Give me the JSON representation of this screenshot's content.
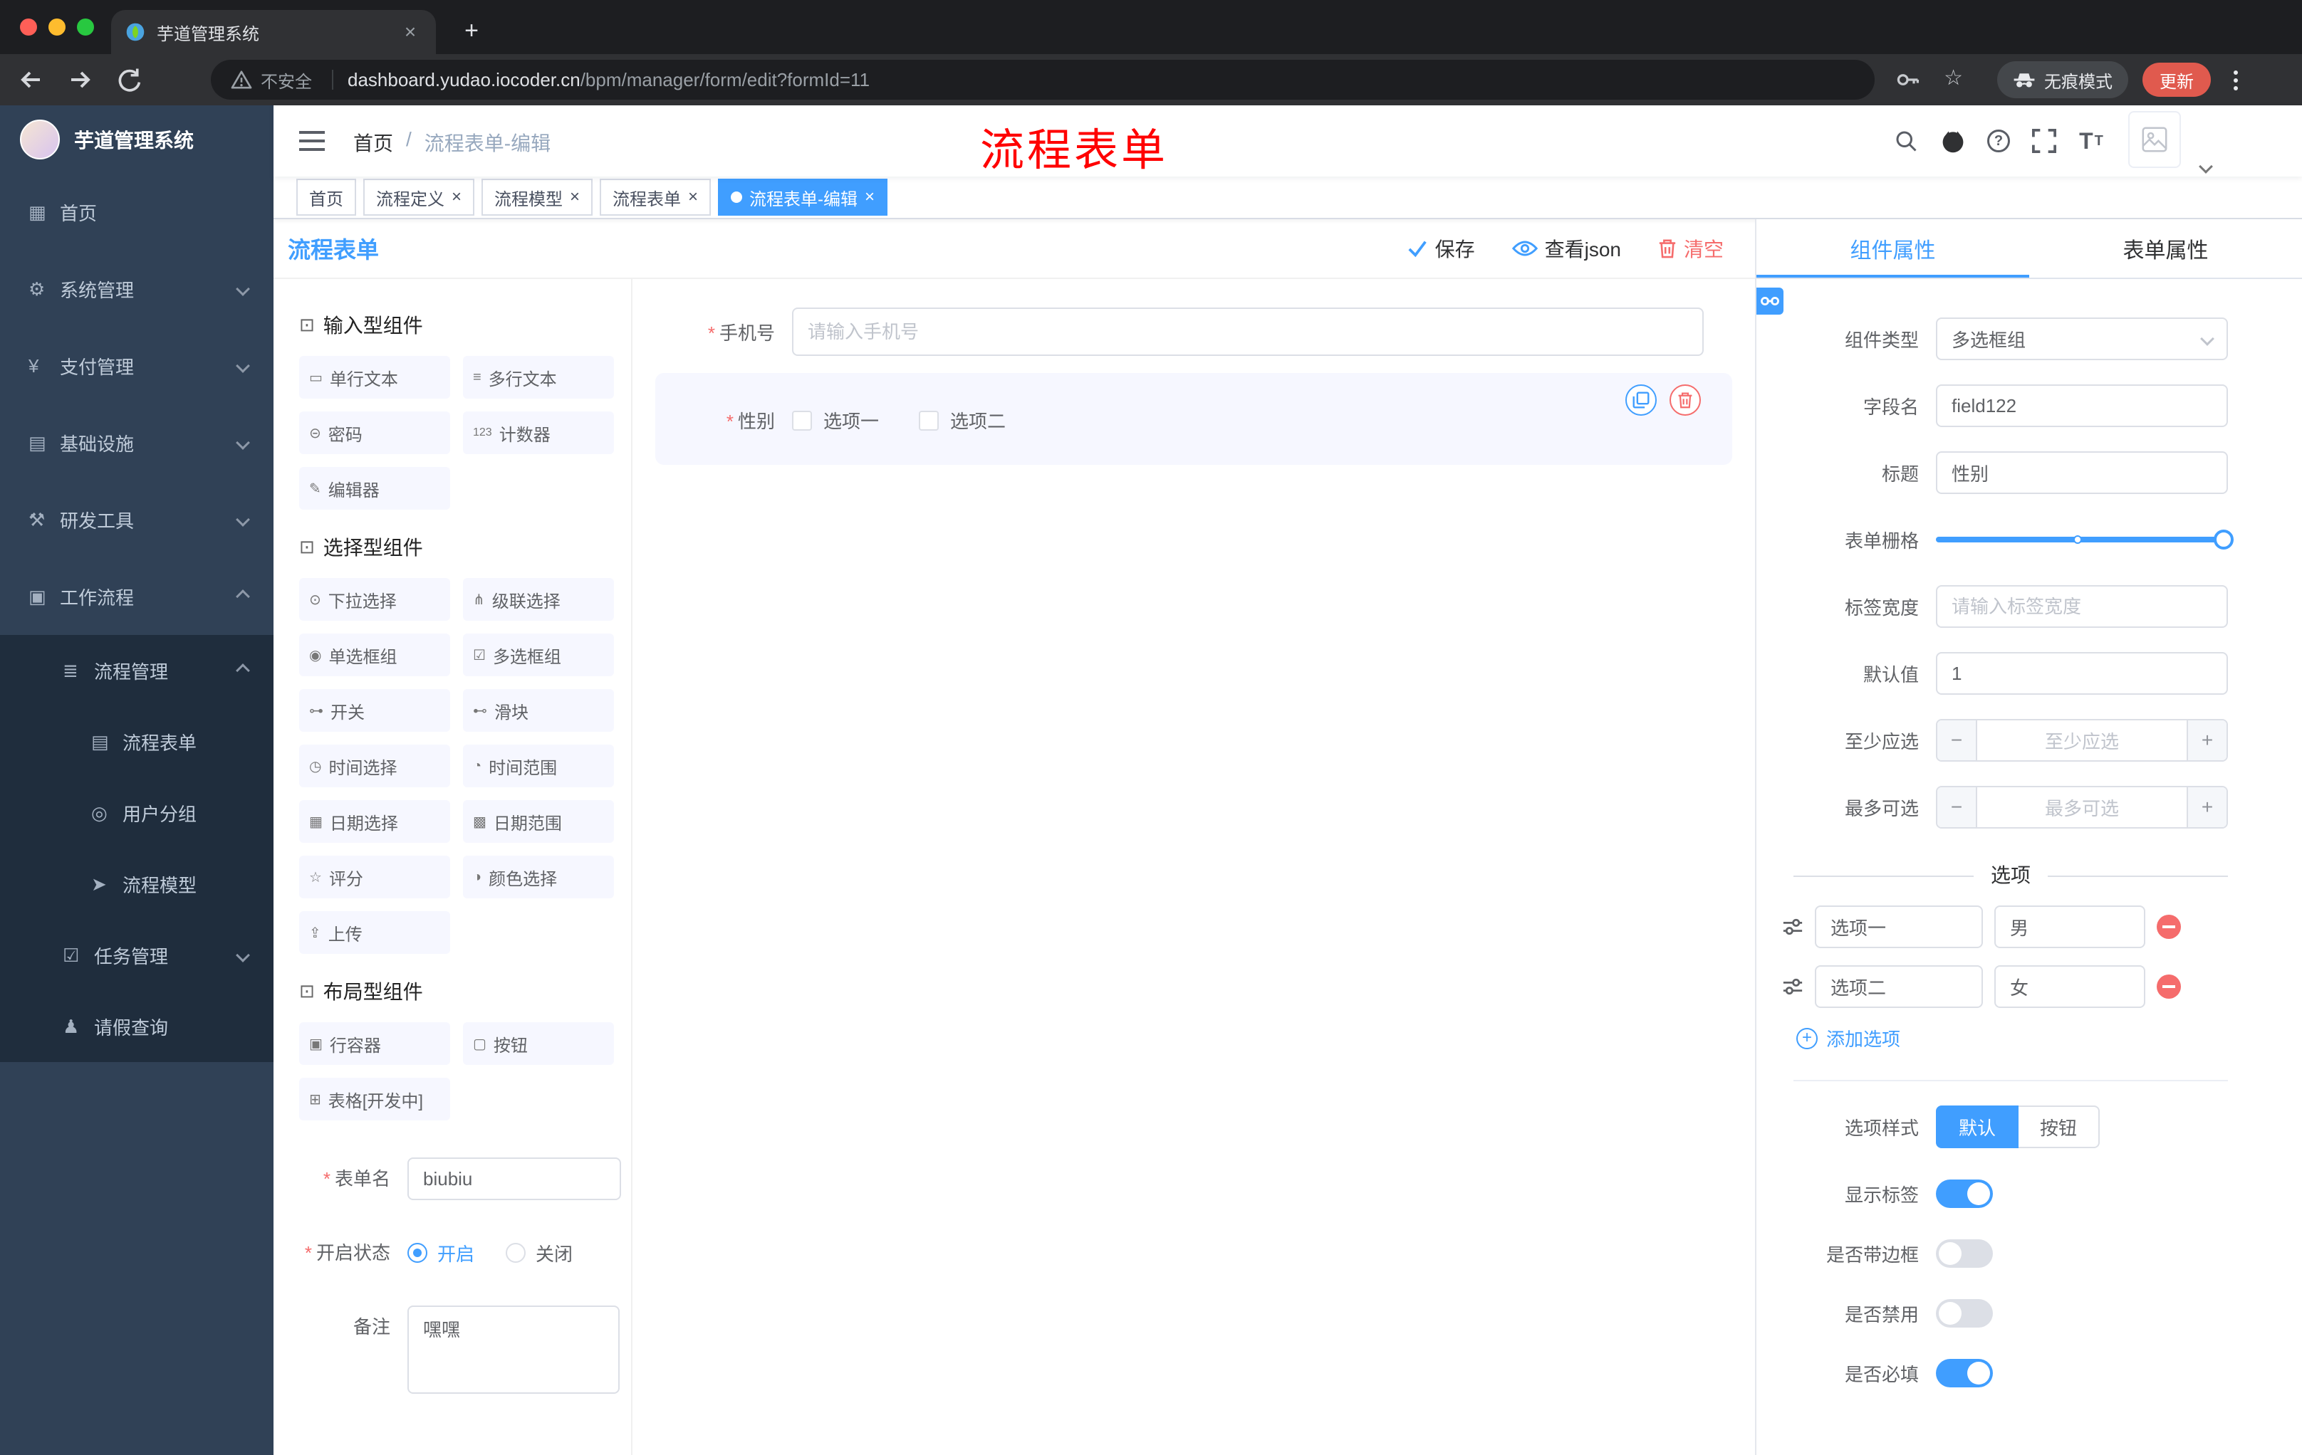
{
  "browser": {
    "tab": {
      "title": "芋道管理系统"
    },
    "address": {
      "security": "不安全",
      "url_host": "dashboard.yudao.iocoder.cn",
      "url_path": "/bpm/manager/form/edit?formId=11",
      "incognito": "无痕模式",
      "update": "更新"
    }
  },
  "sidebar": {
    "logo_title": "芋道管理系统",
    "items": [
      {
        "label": "首页",
        "glyph": "▦"
      },
      {
        "label": "系统管理",
        "glyph": "⚙"
      },
      {
        "label": "支付管理",
        "glyph": "¥"
      },
      {
        "label": "基础设施",
        "glyph": "▤"
      },
      {
        "label": "研发工具",
        "glyph": "⚒"
      },
      {
        "label": "工作流程",
        "glyph": "▣"
      },
      {
        "label": "流程管理",
        "glyph": "≣"
      },
      {
        "label": "流程表单",
        "glyph": "▤"
      },
      {
        "label": "用户分组",
        "glyph": "◎"
      },
      {
        "label": "流程模型",
        "glyph": "➤"
      },
      {
        "label": "任务管理",
        "glyph": "☑"
      },
      {
        "label": "请假查询",
        "glyph": "♟"
      }
    ]
  },
  "navbar": {
    "breadcrumb": {
      "home": "首页",
      "separator": "/",
      "current": "流程表单-编辑"
    },
    "annotation": "流程表单"
  },
  "tags": [
    {
      "label": "首页"
    },
    {
      "label": "流程定义"
    },
    {
      "label": "流程模型"
    },
    {
      "label": "流程表单"
    },
    {
      "label": "流程表单-编辑"
    }
  ],
  "designer": {
    "title": "流程表单",
    "actions": {
      "save": "保存",
      "view_json": "查看json",
      "clear": "清空"
    }
  },
  "palette": {
    "groups": [
      {
        "title": "输入型组件",
        "glyph": "⊡",
        "items": [
          {
            "label": "单行文本",
            "glyph": "▭"
          },
          {
            "label": "多行文本",
            "glyph": "≡"
          },
          {
            "label": "密码",
            "glyph": "⊝"
          },
          {
            "label": "计数器",
            "glyph": "123"
          },
          {
            "label": "编辑器",
            "glyph": "✎"
          }
        ]
      },
      {
        "title": "选择型组件",
        "glyph": "⊡",
        "items": [
          {
            "label": "下拉选择",
            "glyph": "⊙"
          },
          {
            "label": "级联选择",
            "glyph": "⋔"
          },
          {
            "label": "单选框组",
            "glyph": "◉"
          },
          {
            "label": "多选框组",
            "glyph": "☑"
          },
          {
            "label": "开关",
            "glyph": "⊶"
          },
          {
            "label": "滑块",
            "glyph": "⊷"
          },
          {
            "label": "时间选择",
            "glyph": "◷"
          },
          {
            "label": "时间范围",
            "glyph": "◔"
          },
          {
            "label": "日期选择",
            "glyph": "▦"
          },
          {
            "label": "日期范围",
            "glyph": "▩"
          },
          {
            "label": "评分",
            "glyph": "☆"
          },
          {
            "label": "颜色选择",
            "glyph": "◑"
          },
          {
            "label": "上传",
            "glyph": "⇪"
          }
        ]
      },
      {
        "title": "布局型组件",
        "glyph": "⊡",
        "items": [
          {
            "label": "行容器",
            "glyph": "▣"
          },
          {
            "label": "按钮",
            "glyph": "▢"
          },
          {
            "label": "表格[开发中]",
            "glyph": "⊞"
          }
        ]
      }
    ]
  },
  "meta_form": {
    "name_label": "表单名",
    "name_value": "biubiu",
    "status_label": "开启状态",
    "status_on": "开启",
    "status_off": "关闭",
    "remark_label": "备注",
    "remark_value": "嘿嘿"
  },
  "canvas": {
    "phone": {
      "label": "手机号",
      "placeholder": "请输入手机号"
    },
    "gender": {
      "label": "性别",
      "option1": "选项一",
      "option2": "选项二"
    }
  },
  "props": {
    "tab_component": "组件属性",
    "tab_form": "表单属性",
    "component_type_label": "组件类型",
    "component_type_value": "多选框组",
    "field_name_label": "字段名",
    "field_name_value": "field122",
    "title_label": "标题",
    "title_value": "性别",
    "grid_label": "表单栅格",
    "label_width_label": "标签宽度",
    "label_width_placeholder": "请输入标签宽度",
    "default_label": "默认值",
    "default_value": "1",
    "min_label": "至少应选",
    "min_placeholder": "至少应选",
    "max_label": "最多可选",
    "max_placeholder": "最多可选",
    "options_title": "选项",
    "option_rows": [
      {
        "label": "选项一",
        "value": "男"
      },
      {
        "label": "选项二",
        "value": "女"
      }
    ],
    "add_option": "添加选项",
    "style_label": "选项样式",
    "style_default": "默认",
    "style_button": "按钮",
    "toggles": [
      {
        "label": "显示标签",
        "on": true
      },
      {
        "label": "是否带边框",
        "on": false
      },
      {
        "label": "是否禁用",
        "on": false
      },
      {
        "label": "是否必填",
        "on": true
      }
    ]
  },
  "colors": {
    "accent": "#409EFF",
    "danger": "#F56C6C",
    "sidebar_bg": "#304156",
    "sidebar_sub_bg": "#1F2D3D"
  }
}
